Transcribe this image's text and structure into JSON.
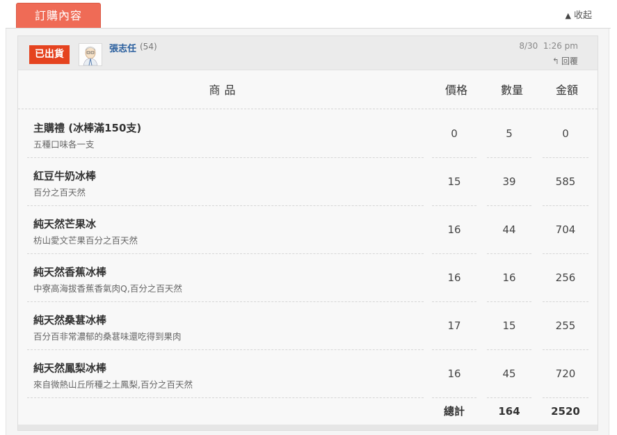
{
  "tab": {
    "label": "訂購內容",
    "collapse_label": "收起"
  },
  "colors": {
    "tab_bg": "#ef6b56",
    "badge_bg": "#e5431f",
    "user_link": "#2a5f9e"
  },
  "order": {
    "status": "已出貨",
    "user": {
      "name": "張志任",
      "count": "(54)"
    },
    "date": "8/30",
    "time": "1:26 pm",
    "reply_label": "回覆"
  },
  "table": {
    "headers": {
      "product": "商品",
      "price": "價格",
      "qty": "數量",
      "amount": "金額"
    },
    "rows": [
      {
        "name": "主購禮 (冰棒滿150支)",
        "desc": "五種口味各一支",
        "price": "0",
        "qty": "5",
        "amount": "0"
      },
      {
        "name": "紅豆牛奶冰棒",
        "desc": "百分之百天然",
        "price": "15",
        "qty": "39",
        "amount": "585"
      },
      {
        "name": "純天然芒果冰",
        "desc": "枋山愛文芒果百分之百天然",
        "price": "16",
        "qty": "44",
        "amount": "704"
      },
      {
        "name": "純天然香蕉冰棒",
        "desc": "中寮高海拔香蕉香氣肉Q,百分之百天然",
        "price": "16",
        "qty": "16",
        "amount": "256"
      },
      {
        "name": "純天然桑葚冰棒",
        "desc": "百分百非常濃郁的桑葚味還吃得到果肉",
        "price": "17",
        "qty": "15",
        "amount": "255"
      },
      {
        "name": "純天然鳳梨冰棒",
        "desc": "來自微熱山丘所種之土鳳梨,百分之百天然",
        "price": "16",
        "qty": "45",
        "amount": "720"
      }
    ],
    "total": {
      "label": "總計",
      "qty": "164",
      "amount": "2520"
    }
  }
}
